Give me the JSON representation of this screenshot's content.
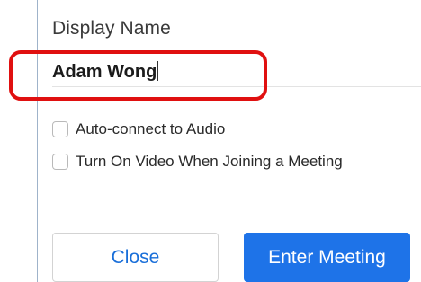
{
  "dialog": {
    "title": "Display Name",
    "display_name_value": "Adam Wong",
    "options": [
      {
        "label": "Auto-connect to Audio",
        "checked": false
      },
      {
        "label": "Turn On Video When Joining a Meeting",
        "checked": false
      }
    ],
    "buttons": {
      "close_label": "Close",
      "enter_label": "Enter Meeting"
    }
  },
  "colors": {
    "highlight": "#e01010",
    "primary": "#1e73e8",
    "link": "#1a6fd9"
  }
}
